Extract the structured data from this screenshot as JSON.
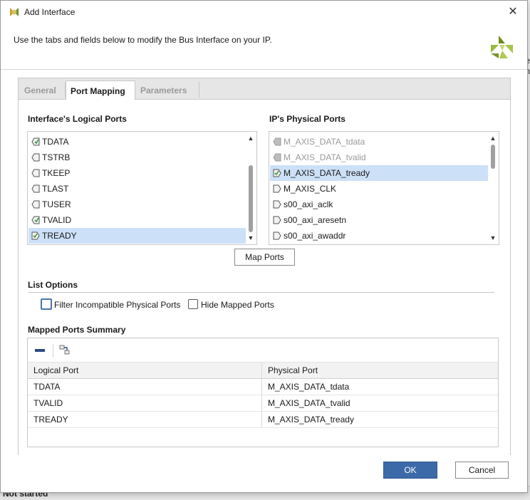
{
  "dialog": {
    "title": "Add Interface",
    "description": "Use the tabs and fields below to modify the Bus Interface on your IP."
  },
  "background": {
    "edge_text_1": "le",
    "edge_text_2": "en",
    "status": "Not started"
  },
  "tabs": [
    {
      "label": "General",
      "active": false
    },
    {
      "label": "Port Mapping",
      "active": true
    },
    {
      "label": "Parameters",
      "active": false
    }
  ],
  "logical_ports": {
    "label": "Interface's Logical Ports",
    "items": [
      {
        "name": "TDATA",
        "icon": "mapped-port-icon",
        "selected": false
      },
      {
        "name": "TSTRB",
        "icon": "port-icon",
        "selected": false
      },
      {
        "name": "TKEEP",
        "icon": "port-icon",
        "selected": false
      },
      {
        "name": "TLAST",
        "icon": "port-icon",
        "selected": false
      },
      {
        "name": "TUSER",
        "icon": "port-icon",
        "selected": false
      },
      {
        "name": "TVALID",
        "icon": "mapped-port-icon",
        "selected": false
      },
      {
        "name": "TREADY",
        "icon": "mapped-input-port-icon",
        "selected": true
      }
    ]
  },
  "physical_ports": {
    "label": "IP's Physical Ports",
    "items": [
      {
        "name": "M_AXIS_DATA_tdata",
        "icon": "output-port-icon",
        "dim": true,
        "selected": false
      },
      {
        "name": "M_AXIS_DATA_tvalid",
        "icon": "output-port-icon",
        "dim": true,
        "selected": false
      },
      {
        "name": "M_AXIS_DATA_tready",
        "icon": "mapped-input-port-icon",
        "dim": false,
        "selected": true
      },
      {
        "name": "M_AXIS_CLK",
        "icon": "input-port-icon",
        "dim": false,
        "selected": false
      },
      {
        "name": "s00_axi_aclk",
        "icon": "input-port-icon",
        "dim": false,
        "selected": false
      },
      {
        "name": "s00_axi_aresetn",
        "icon": "input-port-icon",
        "dim": false,
        "selected": false
      },
      {
        "name": "s00_axi_awaddr",
        "icon": "input-port-icon",
        "dim": false,
        "selected": false
      }
    ]
  },
  "map_ports_button": "Map Ports",
  "list_options": {
    "label": "List Options",
    "filter_incompatible": {
      "label": "Filter Incompatible Physical Ports",
      "checked": false
    },
    "hide_mapped": {
      "label": "Hide Mapped Ports",
      "checked": false
    }
  },
  "mapped_summary": {
    "label": "Mapped Ports Summary",
    "columns": [
      "Logical Port",
      "Physical Port"
    ],
    "rows": [
      [
        "TDATA",
        "M_AXIS_DATA_tdata"
      ],
      [
        "TVALID",
        "M_AXIS_DATA_tvalid"
      ],
      [
        "TREADY",
        "M_AXIS_DATA_tready"
      ]
    ]
  },
  "footer": {
    "ok": "OK",
    "cancel": "Cancel"
  },
  "colors": {
    "accent": "#3c6aa8",
    "selection": "#cce0f7",
    "brand_green": "#8cb43c"
  }
}
